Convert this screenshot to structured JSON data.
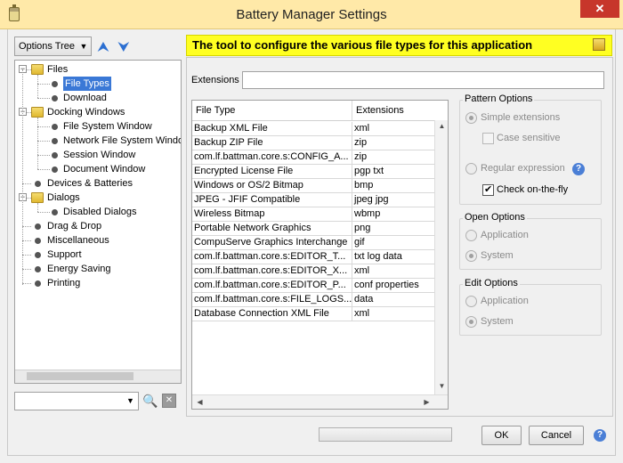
{
  "window": {
    "title": "Battery Manager Settings",
    "close_glyph": "✕"
  },
  "left": {
    "tree_selector": "Options Tree",
    "expand_glyph": "⮝",
    "collapse_glyph": "⮟",
    "tree": [
      {
        "label": "Files",
        "level": 0,
        "expanded": true,
        "folder": true
      },
      {
        "label": "File Types",
        "level": 1,
        "selected": true
      },
      {
        "label": "Download",
        "level": 1
      },
      {
        "label": "Docking Windows",
        "level": 0,
        "expanded": true,
        "folder": true
      },
      {
        "label": "File System Window",
        "level": 1
      },
      {
        "label": "Network File System Window",
        "level": 1
      },
      {
        "label": "Session Window",
        "level": 1
      },
      {
        "label": "Document Window",
        "level": 1
      },
      {
        "label": "Devices & Batteries",
        "level": 0
      },
      {
        "label": "Dialogs",
        "level": 0,
        "expanded": true,
        "folder": true
      },
      {
        "label": "Disabled Dialogs",
        "level": 1
      },
      {
        "label": "Drag & Drop",
        "level": 0
      },
      {
        "label": "Miscellaneous",
        "level": 0
      },
      {
        "label": "Support",
        "level": 0
      },
      {
        "label": "Energy Saving",
        "level": 0
      },
      {
        "label": "Printing",
        "level": 0
      }
    ],
    "search_value": ""
  },
  "header": {
    "text": "The tool to configure the various file types for this application"
  },
  "extensions": {
    "label": "Extensions",
    "value": ""
  },
  "table": {
    "columns": [
      "File Type",
      "Extensions"
    ],
    "rows": [
      [
        "Backup XML File",
        "xml"
      ],
      [
        "Backup ZIP File",
        "zip"
      ],
      [
        "com.lf.battman.core.s:CONFIG_A...",
        "zip"
      ],
      [
        "Encrypted License File",
        "pgp txt"
      ],
      [
        "Windows or OS/2 Bitmap",
        "bmp"
      ],
      [
        "JPEG - JFIF Compatible",
        "jpeg jpg"
      ],
      [
        "Wireless Bitmap",
        "wbmp"
      ],
      [
        "Portable Network Graphics",
        "png"
      ],
      [
        "CompuServe Graphics Interchange",
        "gif"
      ],
      [
        "com.lf.battman.core.s:EDITOR_T...",
        "txt log data"
      ],
      [
        "com.lf.battman.core.s:EDITOR_X...",
        "xml"
      ],
      [
        "com.lf.battman.core.s:EDITOR_P...",
        "conf properties"
      ],
      [
        "com.lf.battman.core.s:FILE_LOGS...",
        "data"
      ],
      [
        "Database Connection XML File",
        "xml"
      ]
    ]
  },
  "pattern_options": {
    "title": "Pattern Options",
    "simple": "Simple extensions",
    "case_sensitive": "Case sensitive",
    "regex": "Regular expression",
    "check_fly": "Check on-the-fly",
    "selected": "simple",
    "check_fly_checked": true,
    "case_sensitive_checked": false
  },
  "open_options": {
    "title": "Open Options",
    "application": "Application",
    "system": "System",
    "selected": "system"
  },
  "edit_options": {
    "title": "Edit Options",
    "application": "Application",
    "system": "System",
    "selected": "system"
  },
  "buttons": {
    "ok": "OK",
    "cancel": "Cancel"
  },
  "help_glyph": "?"
}
